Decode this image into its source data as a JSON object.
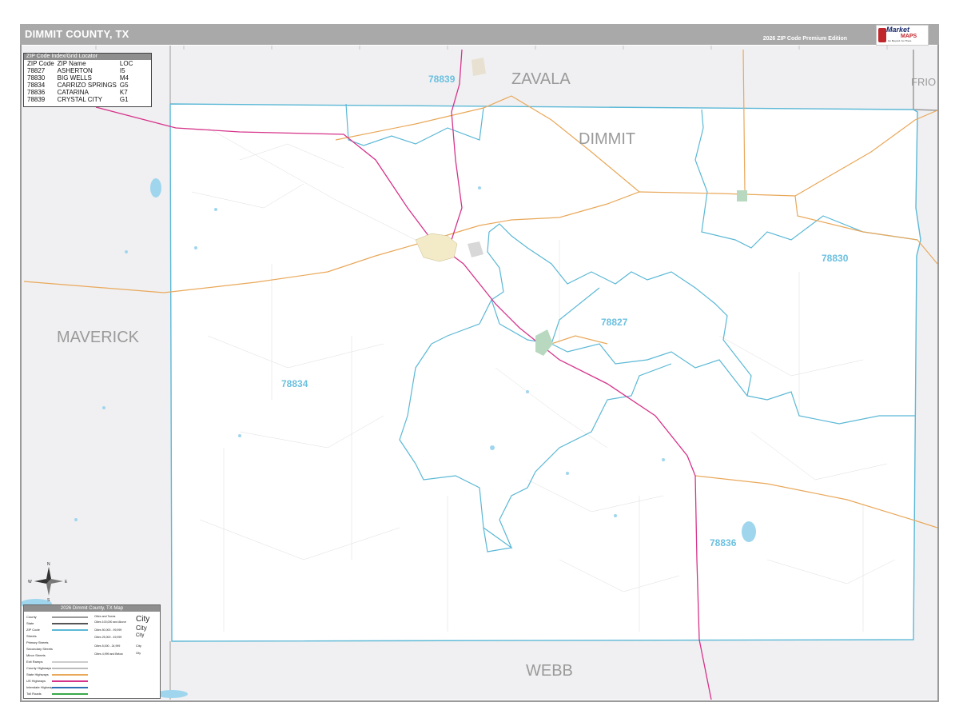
{
  "title": "DIMMIT COUNTY, TX",
  "edition": "2026 ZIP Code Premium Edition",
  "logo": {
    "word1": "Market",
    "word2": "MAPS",
    "tagline": "Go Beyond. Go There."
  },
  "counties": {
    "zavala": "ZAVALA",
    "dimmit": "DIMMIT",
    "maverick": "MAVERICK",
    "webb": "WEBB",
    "frio": "FRIO"
  },
  "zip_labels": [
    "78839",
    "78830",
    "78827",
    "78834",
    "78836"
  ],
  "zip_index": {
    "heading": "ZIP Code Index/Grid Locator",
    "columns": [
      "ZIP Code",
      "ZIP Name",
      "LOC"
    ],
    "rows": [
      [
        "78827",
        "ASHERTON",
        "I5"
      ],
      [
        "78830",
        "BIG WELLS",
        "M4"
      ],
      [
        "78834",
        "CARRIZO SPRINGS",
        "G5"
      ],
      [
        "78836",
        "CATARINA",
        "K7"
      ],
      [
        "78839",
        "CRYSTAL CITY",
        "G1"
      ]
    ]
  },
  "compass": {
    "n": "N",
    "s": "S",
    "e": "E",
    "w": "W"
  },
  "legend": {
    "heading": "2026 Dimmit County, TX Map",
    "items": [
      "County",
      "State",
      "ZIP Code",
      "Streets",
      "Primary Streets",
      "Secondary Streets",
      "Minor Streets",
      "Exit Ramps",
      "County Highways",
      "State Highways",
      "US Highways",
      "Interstate Highways",
      "Toll Roads"
    ],
    "class_heading": "Cities and Towns",
    "classes": [
      [
        "Cities 100,000 and Above",
        "City"
      ],
      [
        "Cities 50,000 - 99,999",
        "City"
      ],
      [
        "Cities 25,000 - 49,999",
        "City"
      ],
      [
        "Cities 5,000 - 24,999",
        "City"
      ],
      [
        "Cities 4,999 and Below",
        "City"
      ]
    ]
  },
  "colors": {
    "zip_boundary": "#5bb8d6",
    "us_highway": "#d6338a",
    "state_highway": "#e9a85a",
    "county_fill": "#f0f0f2",
    "title_bar": "#a9a9a9"
  }
}
